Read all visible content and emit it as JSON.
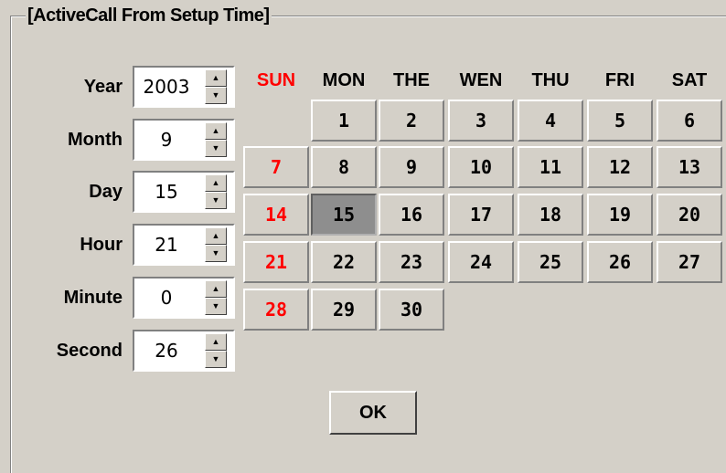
{
  "groupbox": {
    "title": "[ActiveCall From Setup Time]"
  },
  "fields": [
    {
      "label": "Year",
      "value": "2003"
    },
    {
      "label": "Month",
      "value": "9"
    },
    {
      "label": "Day",
      "value": "15"
    },
    {
      "label": "Hour",
      "value": "21"
    },
    {
      "label": "Minute",
      "value": "0"
    },
    {
      "label": "Second",
      "value": "26"
    }
  ],
  "weekdays": [
    "SUN",
    "MON",
    "THE",
    "WEN",
    "THU",
    "FRI",
    "SAT"
  ],
  "calendar": {
    "days": [
      "1",
      "2",
      "3",
      "4",
      "5",
      "6",
      "7",
      "8",
      "9",
      "10",
      "11",
      "12",
      "13",
      "14",
      "15",
      "16",
      "17",
      "18",
      "19",
      "20",
      "21",
      "22",
      "23",
      "24",
      "25",
      "26",
      "27",
      "28",
      "29",
      "30"
    ],
    "selected_day": "15",
    "sunday_color": "#ff0000",
    "selected_color": "#8e8e8e"
  },
  "ok_button": {
    "label": "OK"
  },
  "icons": {
    "spin_up": "spin-up-arrow-icon",
    "spin_down": "spin-down-arrow-icon"
  }
}
